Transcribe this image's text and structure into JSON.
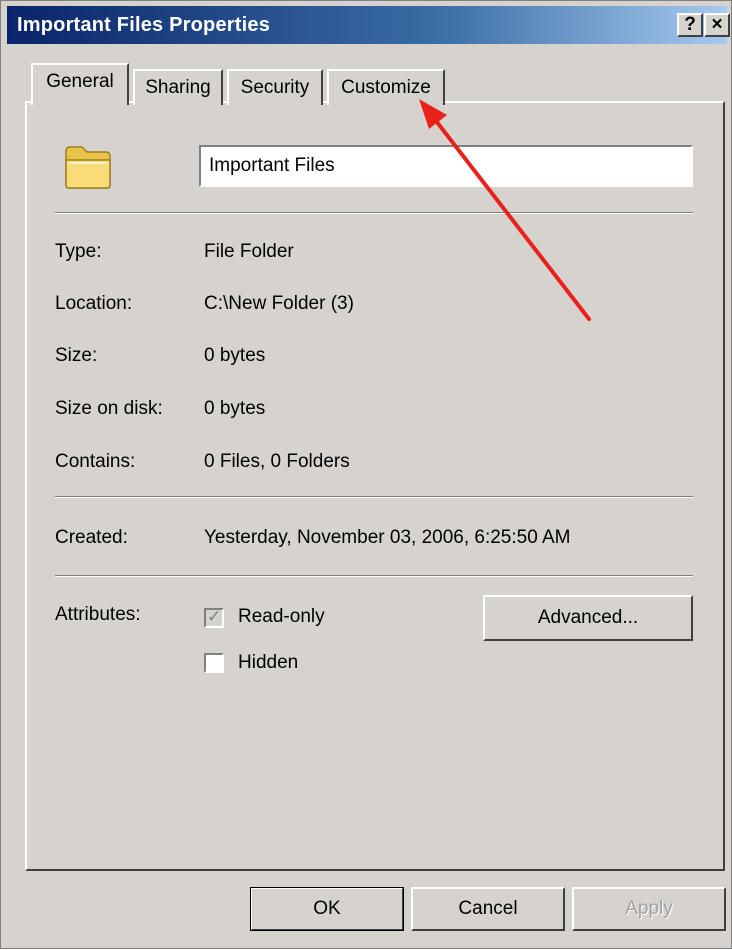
{
  "window": {
    "title": "Important Files Properties",
    "help_glyph": "?",
    "close_glyph": "×"
  },
  "tabs": [
    {
      "label": "General",
      "selected": true
    },
    {
      "label": "Sharing",
      "selected": false
    },
    {
      "label": "Security",
      "selected": false
    },
    {
      "label": "Customize",
      "selected": false
    }
  ],
  "general": {
    "folder_name": "Important Files",
    "rows": [
      {
        "label": "Type:",
        "value": "File Folder"
      },
      {
        "label": "Location:",
        "value": "C:\\New Folder (3)"
      },
      {
        "label": "Size:",
        "value": "0 bytes"
      },
      {
        "label": "Size on disk:",
        "value": "0 bytes"
      },
      {
        "label": "Contains:",
        "value": "0 Files, 0 Folders"
      }
    ],
    "created": {
      "label": "Created:",
      "value": "Yesterday, November 03, 2006, 6:25:50 AM"
    },
    "attributes": {
      "label": "Attributes:",
      "read_only": {
        "label": "Read-only",
        "checked": true,
        "disabled": true
      },
      "hidden": {
        "label": "Hidden",
        "checked": false
      },
      "advanced_button": "Advanced..."
    }
  },
  "buttons": {
    "ok": "OK",
    "cancel": "Cancel",
    "apply": "Apply"
  },
  "annotation": {
    "arrow_color": "#e8221b",
    "points_to": "Customize tab"
  },
  "icons": {
    "folder": "folder-icon",
    "check": "checkmark-icon"
  }
}
